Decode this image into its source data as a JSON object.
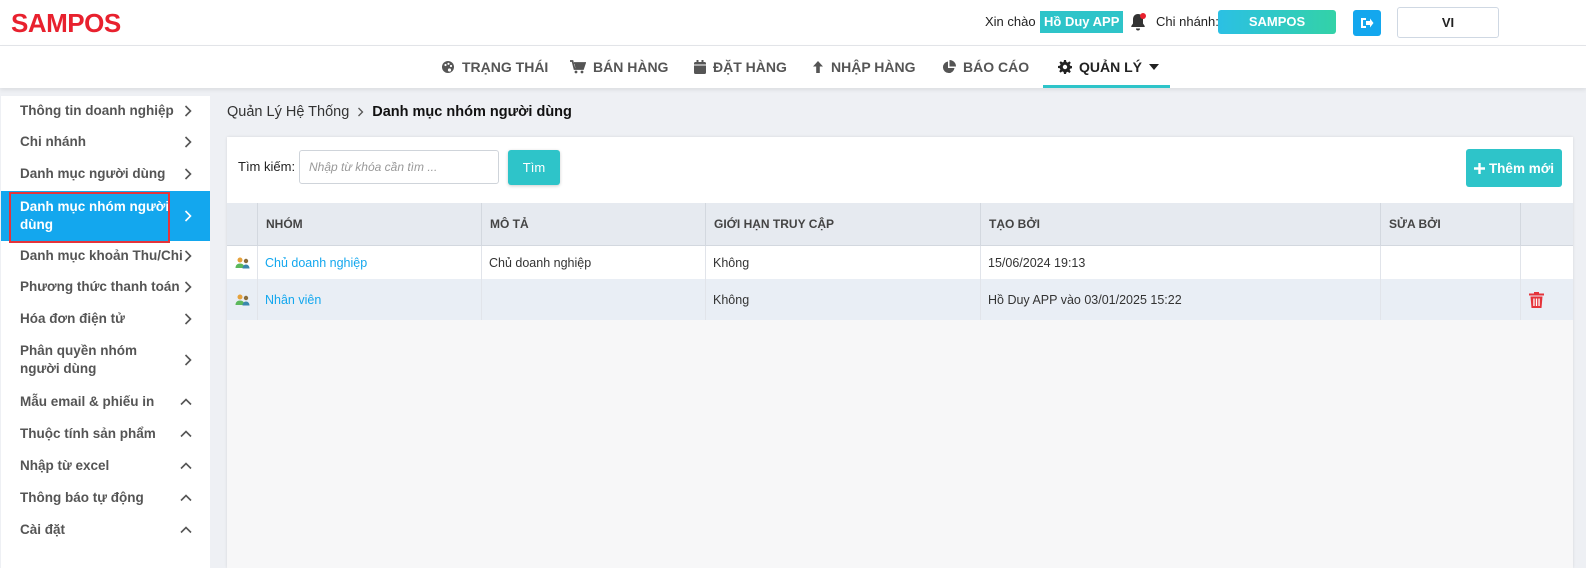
{
  "header": {
    "logo": "SAMPOS",
    "greeting": "Xin chào",
    "user_name": "Hồ Duy APP",
    "branch_label": "Chi nhánh:",
    "branch_name": "SAMPOS",
    "language": "VI"
  },
  "nav": {
    "items": [
      {
        "label": "TRẠNG THÁI",
        "icon": "palette-icon"
      },
      {
        "label": "BÁN HÀNG",
        "icon": "cart-icon"
      },
      {
        "label": "ĐẶT HÀNG",
        "icon": "calendar-icon"
      },
      {
        "label": "NHẬP HÀNG",
        "icon": "arrow-up-icon"
      },
      {
        "label": "BÁO CÁO",
        "icon": "pie-chart-icon"
      },
      {
        "label": "QUẢN LÝ",
        "icon": "gear-icon",
        "active": true
      }
    ]
  },
  "sidebar": {
    "items": [
      {
        "label": "Thông tin doanh nghiệp",
        "chevron": "right"
      },
      {
        "label": "Chi nhánh",
        "chevron": "right"
      },
      {
        "label": "Danh mục người dùng",
        "chevron": "right"
      },
      {
        "label": "Danh mục nhóm người dùng",
        "chevron": "right",
        "active": true
      },
      {
        "label": "Danh mục khoản Thu/Chi",
        "chevron": "right"
      },
      {
        "label": "Phương thức thanh toán",
        "chevron": "right"
      },
      {
        "label": "Hóa đơn điện tử",
        "chevron": "right"
      },
      {
        "label": "Phân quyền nhóm người dùng",
        "chevron": "right"
      },
      {
        "label": "Mẫu email & phiếu in",
        "chevron": "up"
      },
      {
        "label": "Thuộc tính sản phẩm",
        "chevron": "up"
      },
      {
        "label": "Nhập từ excel",
        "chevron": "up"
      },
      {
        "label": "Thông báo tự động",
        "chevron": "up"
      },
      {
        "label": "Cài đặt",
        "chevron": "up"
      }
    ]
  },
  "breadcrumb": {
    "parent": "Quản Lý Hệ Thống",
    "current": "Danh mục nhóm người dùng"
  },
  "toolbar": {
    "search_label": "Tìm kiếm:",
    "search_placeholder": "Nhập từ khóa cần tìm ...",
    "search_value": "",
    "search_button": "Tìm",
    "add_button": "Thêm mới"
  },
  "table": {
    "columns": [
      "NHÓM",
      "MÔ TẢ",
      "GIỚI HẠN TRUY CẬP",
      "TẠO BỞI",
      "SỬA BỞI"
    ],
    "rows": [
      {
        "group": "Chủ doanh nghiệp",
        "description": "Chủ doanh nghiệp",
        "access_limit": "Không",
        "created_by": "15/06/2024 19:13",
        "edited_by": ""
      },
      {
        "group": "Nhân viên",
        "description": "",
        "access_limit": "Không",
        "created_by": "Hồ Duy APP vào 03/01/2025 15:22",
        "edited_by": ""
      }
    ]
  },
  "colors": {
    "brand_red": "#e8212e",
    "accent_teal": "#2ec4c9",
    "accent_blue": "#13a7ee",
    "delete_red": "#e5333a"
  }
}
